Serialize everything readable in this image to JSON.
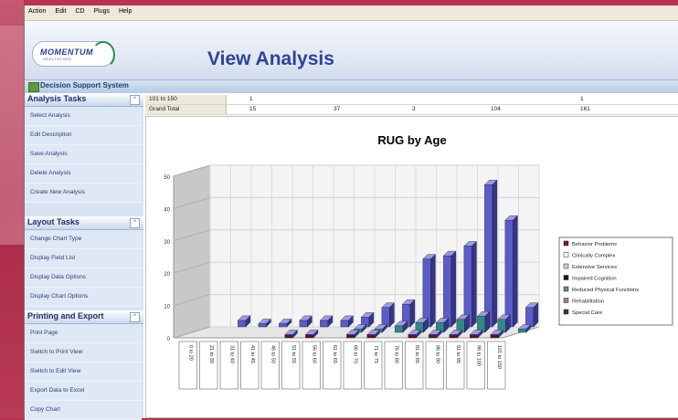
{
  "menu": [
    "Action",
    "Edit",
    "CD",
    "Plugs",
    "Help"
  ],
  "logo": {
    "name": "MOMENTUM",
    "tagline": "HEALTHCARE"
  },
  "page_title": "View Analysis",
  "dss_label": "Decision Support System",
  "sections": [
    {
      "title": "Analysis Tasks",
      "btn": "^",
      "items": [
        "Select Analysis",
        "Edit Description",
        "Save Analysis",
        "Delete Analysis",
        "Create New Analysis"
      ]
    },
    {
      "title": "Layout Tasks",
      "btn": "^",
      "items": [
        "Change Chart Type",
        "Display Field List",
        "Display Data Options",
        "Display Chart Options"
      ]
    },
    {
      "title": "Printing and Export",
      "btn": "^",
      "items": [
        "Print Page",
        "Switch to Print View",
        "Switch to Edit View",
        "Export Data to Excel",
        "Copy Chart"
      ]
    }
  ],
  "grid": {
    "rows": [
      {
        "label": "101 to 150",
        "values": [
          "1",
          "",
          "",
          "",
          "1"
        ]
      },
      {
        "label": "Grand Total",
        "values": [
          "15",
          "37",
          "3",
          "104",
          "161"
        ]
      }
    ]
  },
  "colors": {
    "series_bars": "#5b5bc4",
    "series_teal": "#2f8a88",
    "background": "#b8324f",
    "title": "#2f4394"
  },
  "chart_data": {
    "type": "bar",
    "title": "RUG by Age",
    "ylim": [
      0,
      50
    ],
    "yticks": [
      "0",
      "10",
      "20",
      "30",
      "40",
      "50"
    ],
    "categories": [
      "0 to 20",
      "21 to 30",
      "31 to 40",
      "41 to 45",
      "46 to 50",
      "51 to 55",
      "56 to 60",
      "61 to 65",
      "66 to 70",
      "71 to 75",
      "76 to 80",
      "81 to 85",
      "86 to 90",
      "91 to 95",
      "96 to 100",
      "101 to 150"
    ],
    "legend_position": "right",
    "legend": [
      "Behavior Problems",
      "Clinically Complex",
      "Extensive Services",
      "Impaired Cognition",
      "Reduced Physical Functions",
      "Rehabilitation",
      "Special Care"
    ],
    "legend_colors": [
      "#7a1040",
      "#ffffff",
      "#cfcfcf",
      "#1a1a1a",
      "#6a8a8a",
      "#8a8a8a",
      "#3a3a3a"
    ],
    "series": [
      {
        "name": "Rehabilitation",
        "values": [
          0,
          2,
          1,
          1,
          2,
          2,
          2,
          3,
          6,
          7,
          21,
          22,
          25,
          44,
          33,
          6
        ]
      },
      {
        "name": "Special Care",
        "values": [
          0,
          0,
          0,
          0,
          0,
          0,
          0,
          1,
          1,
          2,
          3,
          3,
          4,
          5,
          4,
          1
        ]
      },
      {
        "name": "Behavior Problems",
        "values": [
          0,
          0,
          0,
          0,
          1,
          1,
          0,
          1,
          1,
          0,
          1,
          1,
          1,
          1,
          1,
          0
        ]
      }
    ]
  }
}
